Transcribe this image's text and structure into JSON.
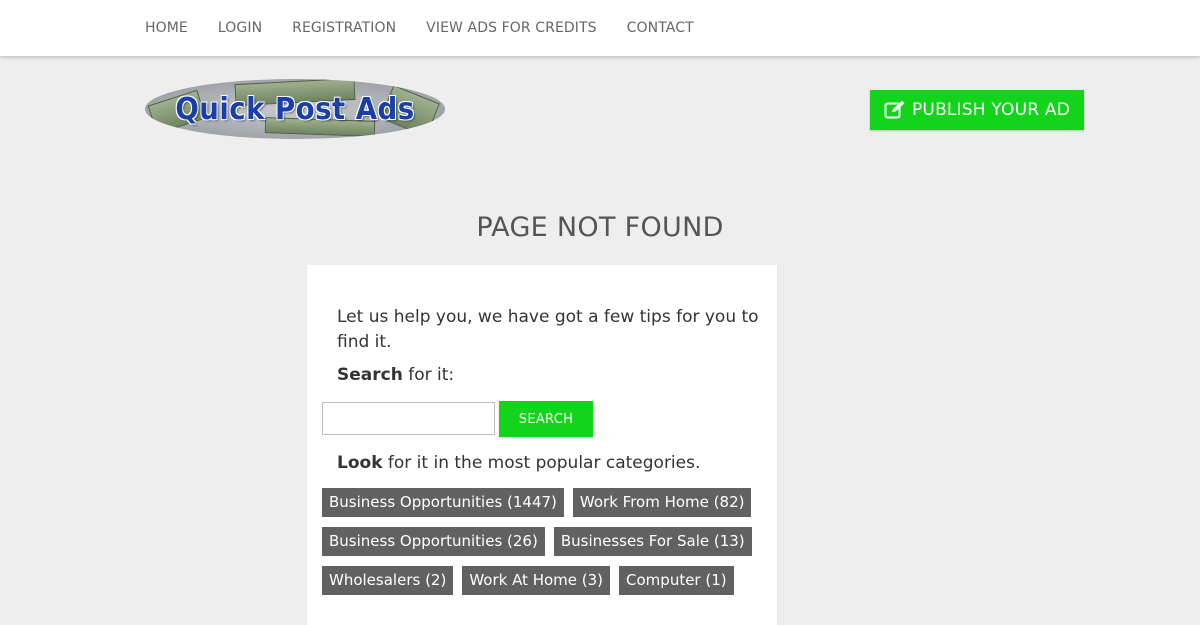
{
  "nav": {
    "items": [
      "HOME",
      "LOGIN",
      "REGISTRATION",
      "VIEW ADS FOR CREDITS",
      "CONTACT"
    ]
  },
  "header": {
    "logo_text": "Quick Post Ads",
    "publish_label": "PUBLISH YOUR AD"
  },
  "main": {
    "title": "PAGE NOT FOUND",
    "help_text": "Let us help you, we have got a few tips for you to find it.",
    "search_strong": "Search",
    "search_rest": " for it:",
    "search_input_value": "",
    "search_button": "SEARCH",
    "look_strong": "Look",
    "look_rest": " for it in the most popular categories.",
    "categories": [
      "Business Opportunities (1447)",
      "Work From Home (82)",
      "Business Opportunities (26)",
      "Businesses For Sale (13)",
      "Wholesalers (2)",
      "Work At Home (3)",
      "Computer (1)"
    ]
  },
  "colors": {
    "accent_green": "#12d41a",
    "category_bg": "#616161",
    "page_bg": "#eeeeee"
  },
  "icons": {
    "publish": "edit-icon"
  }
}
